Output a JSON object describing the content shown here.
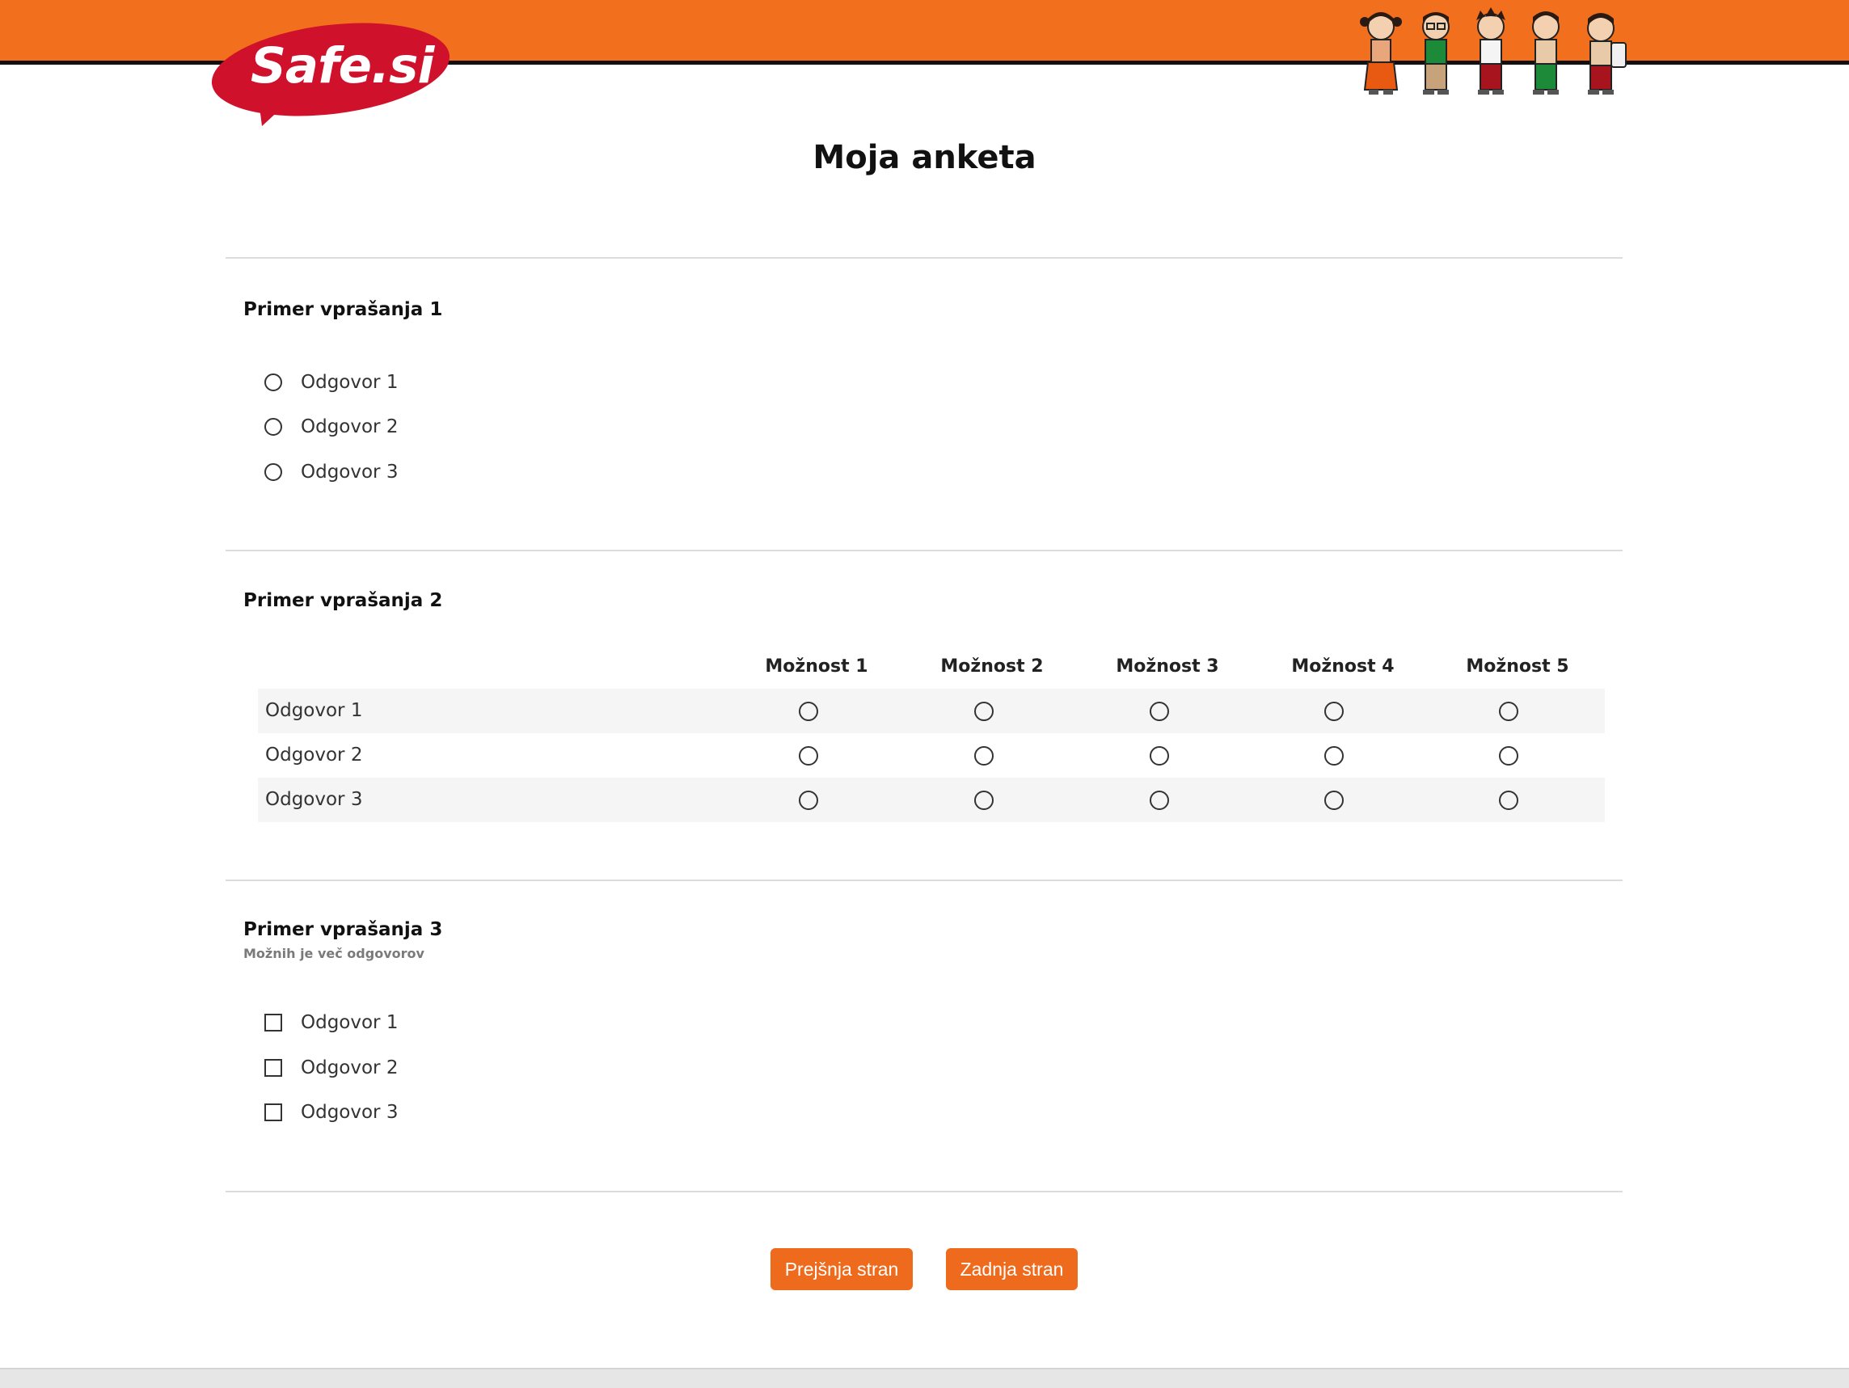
{
  "header": {
    "logo_text": "Safe.si"
  },
  "survey": {
    "title": "Moja anketa",
    "q1": {
      "title": "Primer vprašanja 1",
      "options": [
        "Odgovor 1",
        "Odgovor 2",
        "Odgovor 3"
      ]
    },
    "q2": {
      "title": "Primer vprašanja 2",
      "columns": [
        "Možnost 1",
        "Možnost 2",
        "Možnost 3",
        "Možnost 4",
        "Možnost 5"
      ],
      "rows": [
        "Odgovor 1",
        "Odgovor 2",
        "Odgovor 3"
      ]
    },
    "q3": {
      "title": "Primer vprašanja 3",
      "hint": "Možnih je več odgovorov",
      "options": [
        "Odgovor 1",
        "Odgovor 2",
        "Odgovor 3"
      ]
    }
  },
  "nav": {
    "prev_label": "Prejšnja stran",
    "next_label": "Zadnja stran"
  },
  "colors": {
    "brand_orange": "#f26f1d",
    "logo_red": "#d0112b",
    "button_orange": "#ee6a1c"
  }
}
